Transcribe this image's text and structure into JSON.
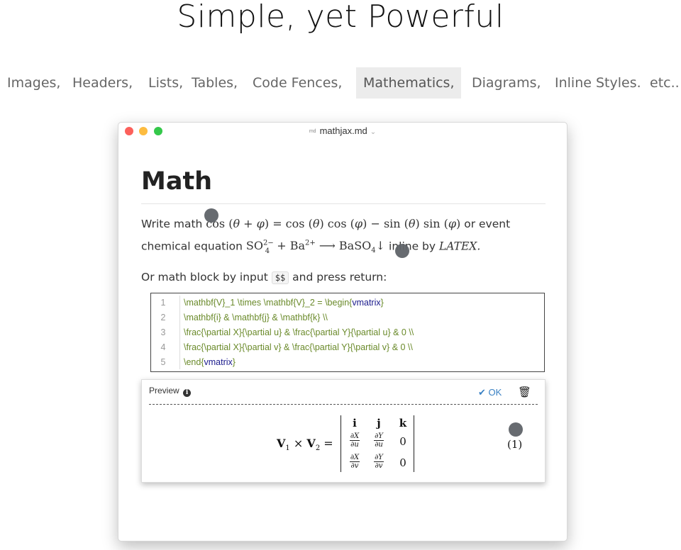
{
  "page": {
    "headline": "Simple, yet Powerful",
    "features": [
      "Images,",
      "Headers,",
      "Lists,",
      "Tables,",
      "Code Fences,",
      "Mathematics,",
      "Diagrams,",
      "Inline Styles.",
      "etc.."
    ],
    "active_feature": "Mathematics,"
  },
  "window": {
    "filename": "mathjax.md",
    "file_icon": "markdown-file-icon",
    "traffic_lights": {
      "close": "#fc605b",
      "minimize": "#fdbc40",
      "zoom": "#34c84a"
    }
  },
  "doc": {
    "heading": "Math",
    "p1_lead": "Write math",
    "p1_math": "cos(θ+φ) = cos(θ)cos(φ) − sin(θ)sin(φ)",
    "p1_tail": "or event",
    "p2_lead": "chemical equation",
    "p2_math_so": "SO",
    "p2_math_so_sub": "4",
    "p2_math_so_sup": "2−",
    "p2_math_plus": "+ Ba",
    "p2_math_ba_sup": "2+",
    "p2_math_arrow": "⟶ BaSO",
    "p2_math_baso_sub": "4",
    "p2_math_down": "↓",
    "p2_tail": "inline by",
    "latex": "LATEX.",
    "p3_lead": "Or math block by input",
    "p3_code": "$$",
    "p3_tail": "and press return:"
  },
  "code_block": {
    "lines": [
      {
        "n": "1",
        "a": "\\mathbf{V}_1 \\times \\mathbf{V}_2 =  \\begin{",
        "b": "vmatrix",
        "c": "}"
      },
      {
        "n": "2",
        "a": "\\mathbf{i} & \\mathbf{j} & \\mathbf{k} \\\\",
        "b": "",
        "c": ""
      },
      {
        "n": "3",
        "a": "\\frac{\\partial X}{\\partial u} &  \\frac{\\partial Y}{\\partial u} & 0 \\\\",
        "b": "",
        "c": ""
      },
      {
        "n": "4",
        "a": "\\frac{\\partial X}{\\partial v} &  \\frac{\\partial Y}{\\partial v} & 0 \\\\",
        "b": "",
        "c": ""
      },
      {
        "n": "5",
        "a": "\\end{",
        "b": "vmatrix",
        "c": "}"
      }
    ]
  },
  "preview": {
    "label": "Preview",
    "info_icon": "info-circle-icon",
    "ok_label": "OK",
    "ok_icon": "checkmark-icon",
    "delete_icon": "trash-icon",
    "lhs_v1": "V",
    "lhs_sub1": "1",
    "lhs_times": "×",
    "lhs_v2": "V",
    "lhs_sub2": "2",
    "lhs_eq": "=",
    "matrix": {
      "row1": [
        "i",
        "j",
        "k"
      ],
      "row2": [
        {
          "num": "∂X",
          "den": "∂u"
        },
        {
          "num": "∂Y",
          "den": "∂u"
        },
        "0"
      ],
      "row3": [
        {
          "num": "∂X",
          "den": "∂v"
        },
        {
          "num": "∂Y",
          "den": "∂v"
        },
        "0"
      ]
    },
    "equation_number": "(1)"
  },
  "colors": {
    "accent": "#3b82c4",
    "code_green": "#6a8a2a",
    "code_keyword": "#1a1a8c",
    "active_tab_bg": "#ececec"
  }
}
